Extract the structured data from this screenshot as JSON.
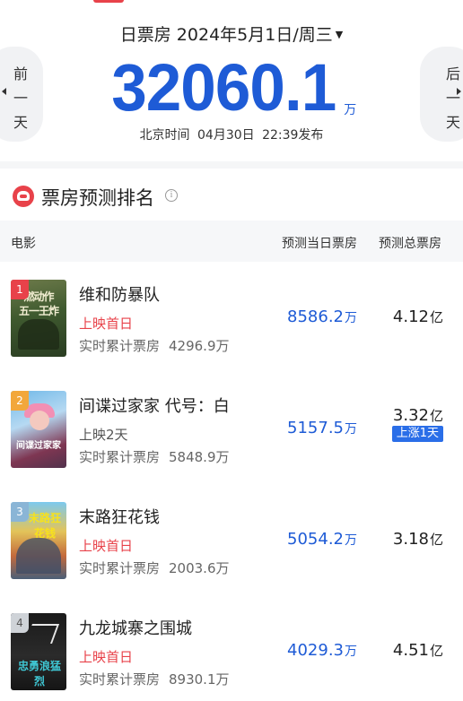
{
  "header": {
    "date_label": "日票房 2024年5月1日/周三",
    "prev_day": "前一天",
    "next_day": "后一天",
    "total_value": "32060.1",
    "total_unit": "万",
    "publish_time": "北京时间 04月30日 22:39发布"
  },
  "section": {
    "title": "票房预测排名",
    "info_icon": "i"
  },
  "columns": {
    "movie": "电影",
    "day_forecast": "预测当日票房",
    "total_forecast": "预测总票房"
  },
  "movies": [
    {
      "rank": "1",
      "title": "维和防暴队",
      "poster_line1": "燃动作",
      "poster_line2": "五一王炸",
      "release": "上映首日",
      "cum_label": "实时累计票房",
      "cum_value": "4296.9万",
      "day_value": "8586.2",
      "day_unit": "万",
      "total_value": "4.12",
      "total_unit": "亿"
    },
    {
      "rank": "2",
      "title": "间谍过家家 代号：白",
      "poster_text": "间谍过家家",
      "release": "上映2天",
      "cum_label": "实时累计票房",
      "cum_value": "5848.9万",
      "day_value": "5157.5",
      "day_unit": "万",
      "total_value": "3.32",
      "total_unit": "亿",
      "badge": "上涨1天"
    },
    {
      "rank": "3",
      "title": "末路狂花钱",
      "poster_text": "末路狂花钱",
      "release": "上映首日",
      "cum_label": "实时累计票房",
      "cum_value": "2003.6万",
      "day_value": "5054.2",
      "day_unit": "万",
      "total_value": "3.18",
      "total_unit": "亿"
    },
    {
      "rank": "4",
      "title": "九龙城寨之围城",
      "poster_text": "忠勇浪猛烈",
      "release": "上映首日",
      "cum_label": "实时累计票房",
      "cum_value": "8930.1万",
      "day_value": "4029.3",
      "day_unit": "万",
      "total_value": "4.51",
      "total_unit": "亿"
    }
  ],
  "colors": {
    "accent_blue": "#1e5bd6",
    "accent_red": "#e8424a",
    "badge_blue": "#2a6ee8"
  }
}
